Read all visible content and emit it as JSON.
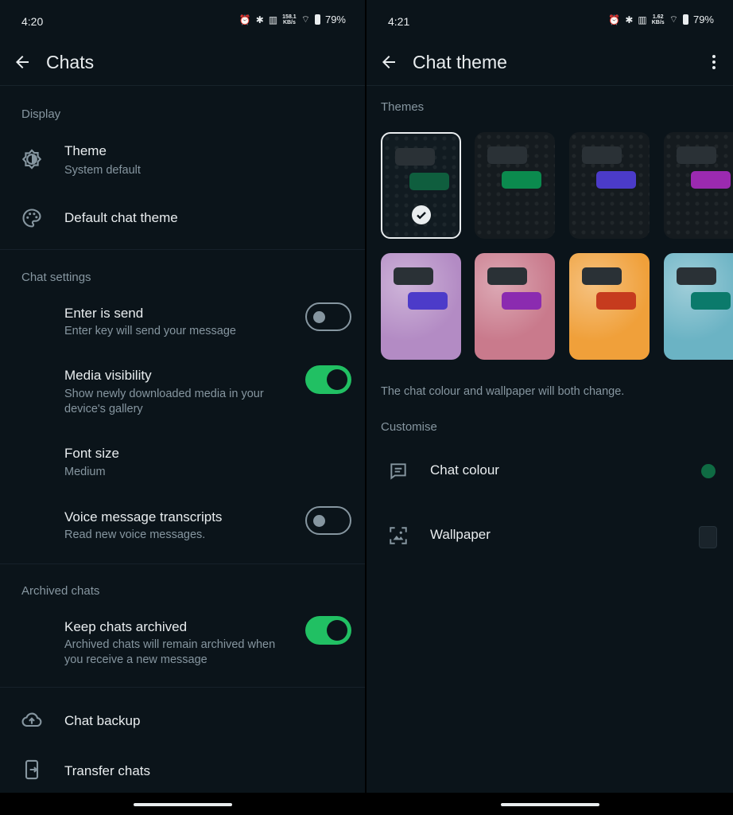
{
  "left": {
    "status": {
      "time": "4:20",
      "speed_top": "158.1",
      "speed_bottom": "KB/s",
      "battery": "79%"
    },
    "appbar": {
      "title": "Chats"
    },
    "display": {
      "label": "Display",
      "theme": {
        "title": "Theme",
        "sub": "System default"
      },
      "default_chat_theme": {
        "title": "Default chat theme"
      }
    },
    "chat_settings": {
      "label": "Chat settings",
      "enter_is_send": {
        "title": "Enter is send",
        "sub": "Enter key will send your message",
        "on": false
      },
      "media_visibility": {
        "title": "Media visibility",
        "sub": "Show newly downloaded media in your device's gallery",
        "on": true
      },
      "font_size": {
        "title": "Font size",
        "sub": "Medium"
      },
      "voice_transcripts": {
        "title": "Voice message transcripts",
        "sub": "Read new voice messages.",
        "on": false
      }
    },
    "archived": {
      "label": "Archived chats",
      "keep_archived": {
        "title": "Keep chats archived",
        "sub": "Archived chats will remain archived when you receive a new message",
        "on": true
      }
    },
    "chat_backup": {
      "title": "Chat backup"
    },
    "transfer_chats": {
      "title": "Transfer chats"
    }
  },
  "right": {
    "status": {
      "time": "4:21",
      "speed_top": "1.62",
      "speed_bottom": "KB/s",
      "battery": "79%"
    },
    "appbar": {
      "title": "Chat theme"
    },
    "themes_label": "Themes",
    "themes": [
      {
        "name": "dark-green-selected",
        "bg": "#111b21",
        "bubble": "#0f5e3e",
        "selected": true
      },
      {
        "name": "dark-green",
        "bg": "#151b1f",
        "bubble": "#0b8a4e",
        "selected": false
      },
      {
        "name": "dark-purple",
        "bg": "#151b1f",
        "bubble": "#4b3bc9",
        "selected": false
      },
      {
        "name": "dark-magenta",
        "bg": "#151b1f",
        "bubble": "#9b2ab0",
        "selected": false
      },
      {
        "name": "pastel-purple",
        "bg": "#b38bc4",
        "bubble": "#4c3bc9",
        "selected": false
      },
      {
        "name": "pink-floral",
        "bg": "#c97a8c",
        "bubble": "#8b2bb0",
        "selected": false
      },
      {
        "name": "orange-flower",
        "bg": "#f0a03a",
        "bubble": "#c63b1e",
        "selected": false
      },
      {
        "name": "beach",
        "bg": "#6bb3c4",
        "bubble": "#0b7a6b",
        "selected": false
      }
    ],
    "hint": "The chat colour and wallpaper will both change.",
    "customise_label": "Customise",
    "chat_colour": {
      "title": "Chat colour",
      "swatch": "#0f6b43"
    },
    "wallpaper": {
      "title": "Wallpaper"
    }
  }
}
